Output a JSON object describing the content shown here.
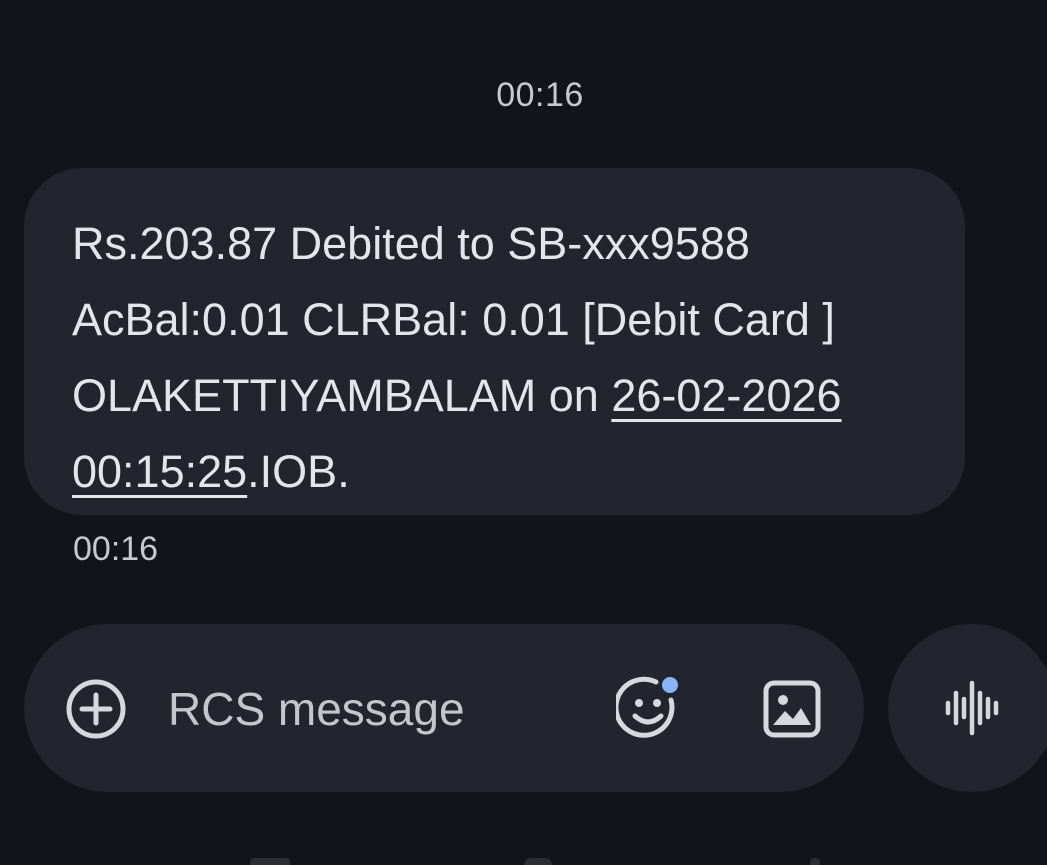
{
  "conversation": {
    "date_header": "00:16",
    "messages": [
      {
        "text_before": "Rs.203.87 Debited to SB-xxx9588\nAcBal:0.01 CLRBal: 0.01 [Debit Card ]\nOLAKETTIYAMBALAM on ",
        "link_text": "26-02-2026\n00:15:25",
        "text_after": ".IOB.",
        "time": "00:16"
      }
    ]
  },
  "composer": {
    "placeholder": "RCS message",
    "add_icon": "plus-circle-icon",
    "emoji_icon": "emoji-icon",
    "gallery_icon": "image-icon",
    "voice_icon": "voice-waveform-icon"
  },
  "colors": {
    "background": "#12141b",
    "bubble": "#22252e",
    "text": "#e4e4ec",
    "accent_dot": "#8ab4f8"
  }
}
